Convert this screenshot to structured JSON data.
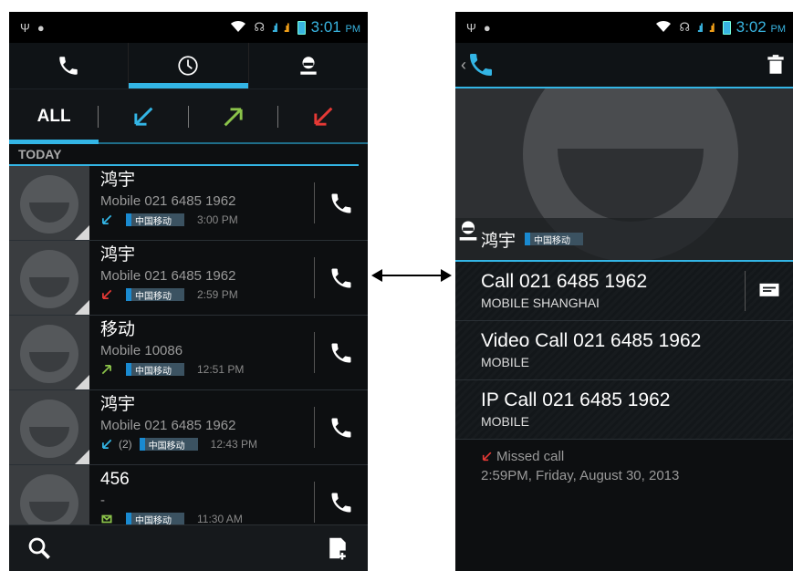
{
  "left": {
    "status": {
      "time": "3:01",
      "ampm": "PM"
    },
    "filters": {
      "all": "ALL"
    },
    "section": "TODAY",
    "calls": [
      {
        "name": "鸿宇",
        "number": "Mobile 021 6485 1962",
        "type": "incoming",
        "count": "",
        "carrier": "中国移动",
        "time": "3:00 PM"
      },
      {
        "name": "鸿宇",
        "number": "Mobile 021 6485 1962",
        "type": "missed",
        "count": "",
        "carrier": "中国移动",
        "time": "2:59 PM"
      },
      {
        "name": "移动",
        "number": "Mobile 10086",
        "type": "outgoing",
        "count": "",
        "carrier": "中国移动",
        "time": "12:51 PM"
      },
      {
        "name": "鸿宇",
        "number": "Mobile 021 6485 1962",
        "type": "incoming",
        "count": "(2)",
        "carrier": "中国移动",
        "time": "12:43 PM"
      },
      {
        "name": "456",
        "number": "-",
        "type": "voicemail",
        "count": "",
        "carrier": "中国移动",
        "time": "11:30 AM"
      }
    ],
    "colors": {
      "accent": "#33b5e5",
      "incoming": "#33b5e5",
      "outgoing": "#8bc34a",
      "missed": "#e53935"
    }
  },
  "right": {
    "status": {
      "time": "3:02",
      "ampm": "PM"
    },
    "back_glyph": "‹",
    "contact": {
      "name": "鸿宇",
      "carrier": "中国移动"
    },
    "options": [
      {
        "title": "Call 021 6485 1962",
        "subtitle": "MOBILE  SHANGHAI",
        "has_msg": true
      },
      {
        "title": "Video Call 021 6485 1962",
        "subtitle": "MOBILE",
        "has_msg": false
      },
      {
        "title": "IP Call 021 6485 1962",
        "subtitle": "MOBILE",
        "has_msg": false
      }
    ],
    "history": {
      "label": "Missed call",
      "detail": "2:59PM, Friday, August 30, 2013"
    }
  }
}
